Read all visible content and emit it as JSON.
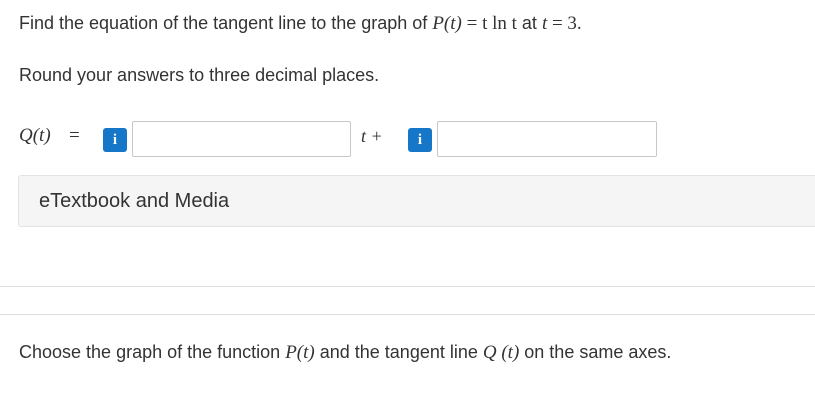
{
  "question": {
    "prefix": "Find the equation of the tangent line to the graph of ",
    "function_name": "P(t)",
    "equals": " = ",
    "function_expr": "t ln t",
    "at_word": " at ",
    "point_var": "t",
    "point_value": " = 3."
  },
  "instruction": "Round your answers to three decimal places.",
  "answer": {
    "label": "Q(t)",
    "equals": "=",
    "info_icon": "i",
    "slope_value": "",
    "middle_text": "t +",
    "intercept_value": ""
  },
  "etextbook": {
    "label": "eTextbook and Media"
  },
  "graph_prompt": {
    "prefix": "Choose the graph of the function ",
    "function_name": "P(t)",
    "middle": " and the tangent line ",
    "tangent_name": "Q (t)",
    "suffix": " on the same axes."
  }
}
